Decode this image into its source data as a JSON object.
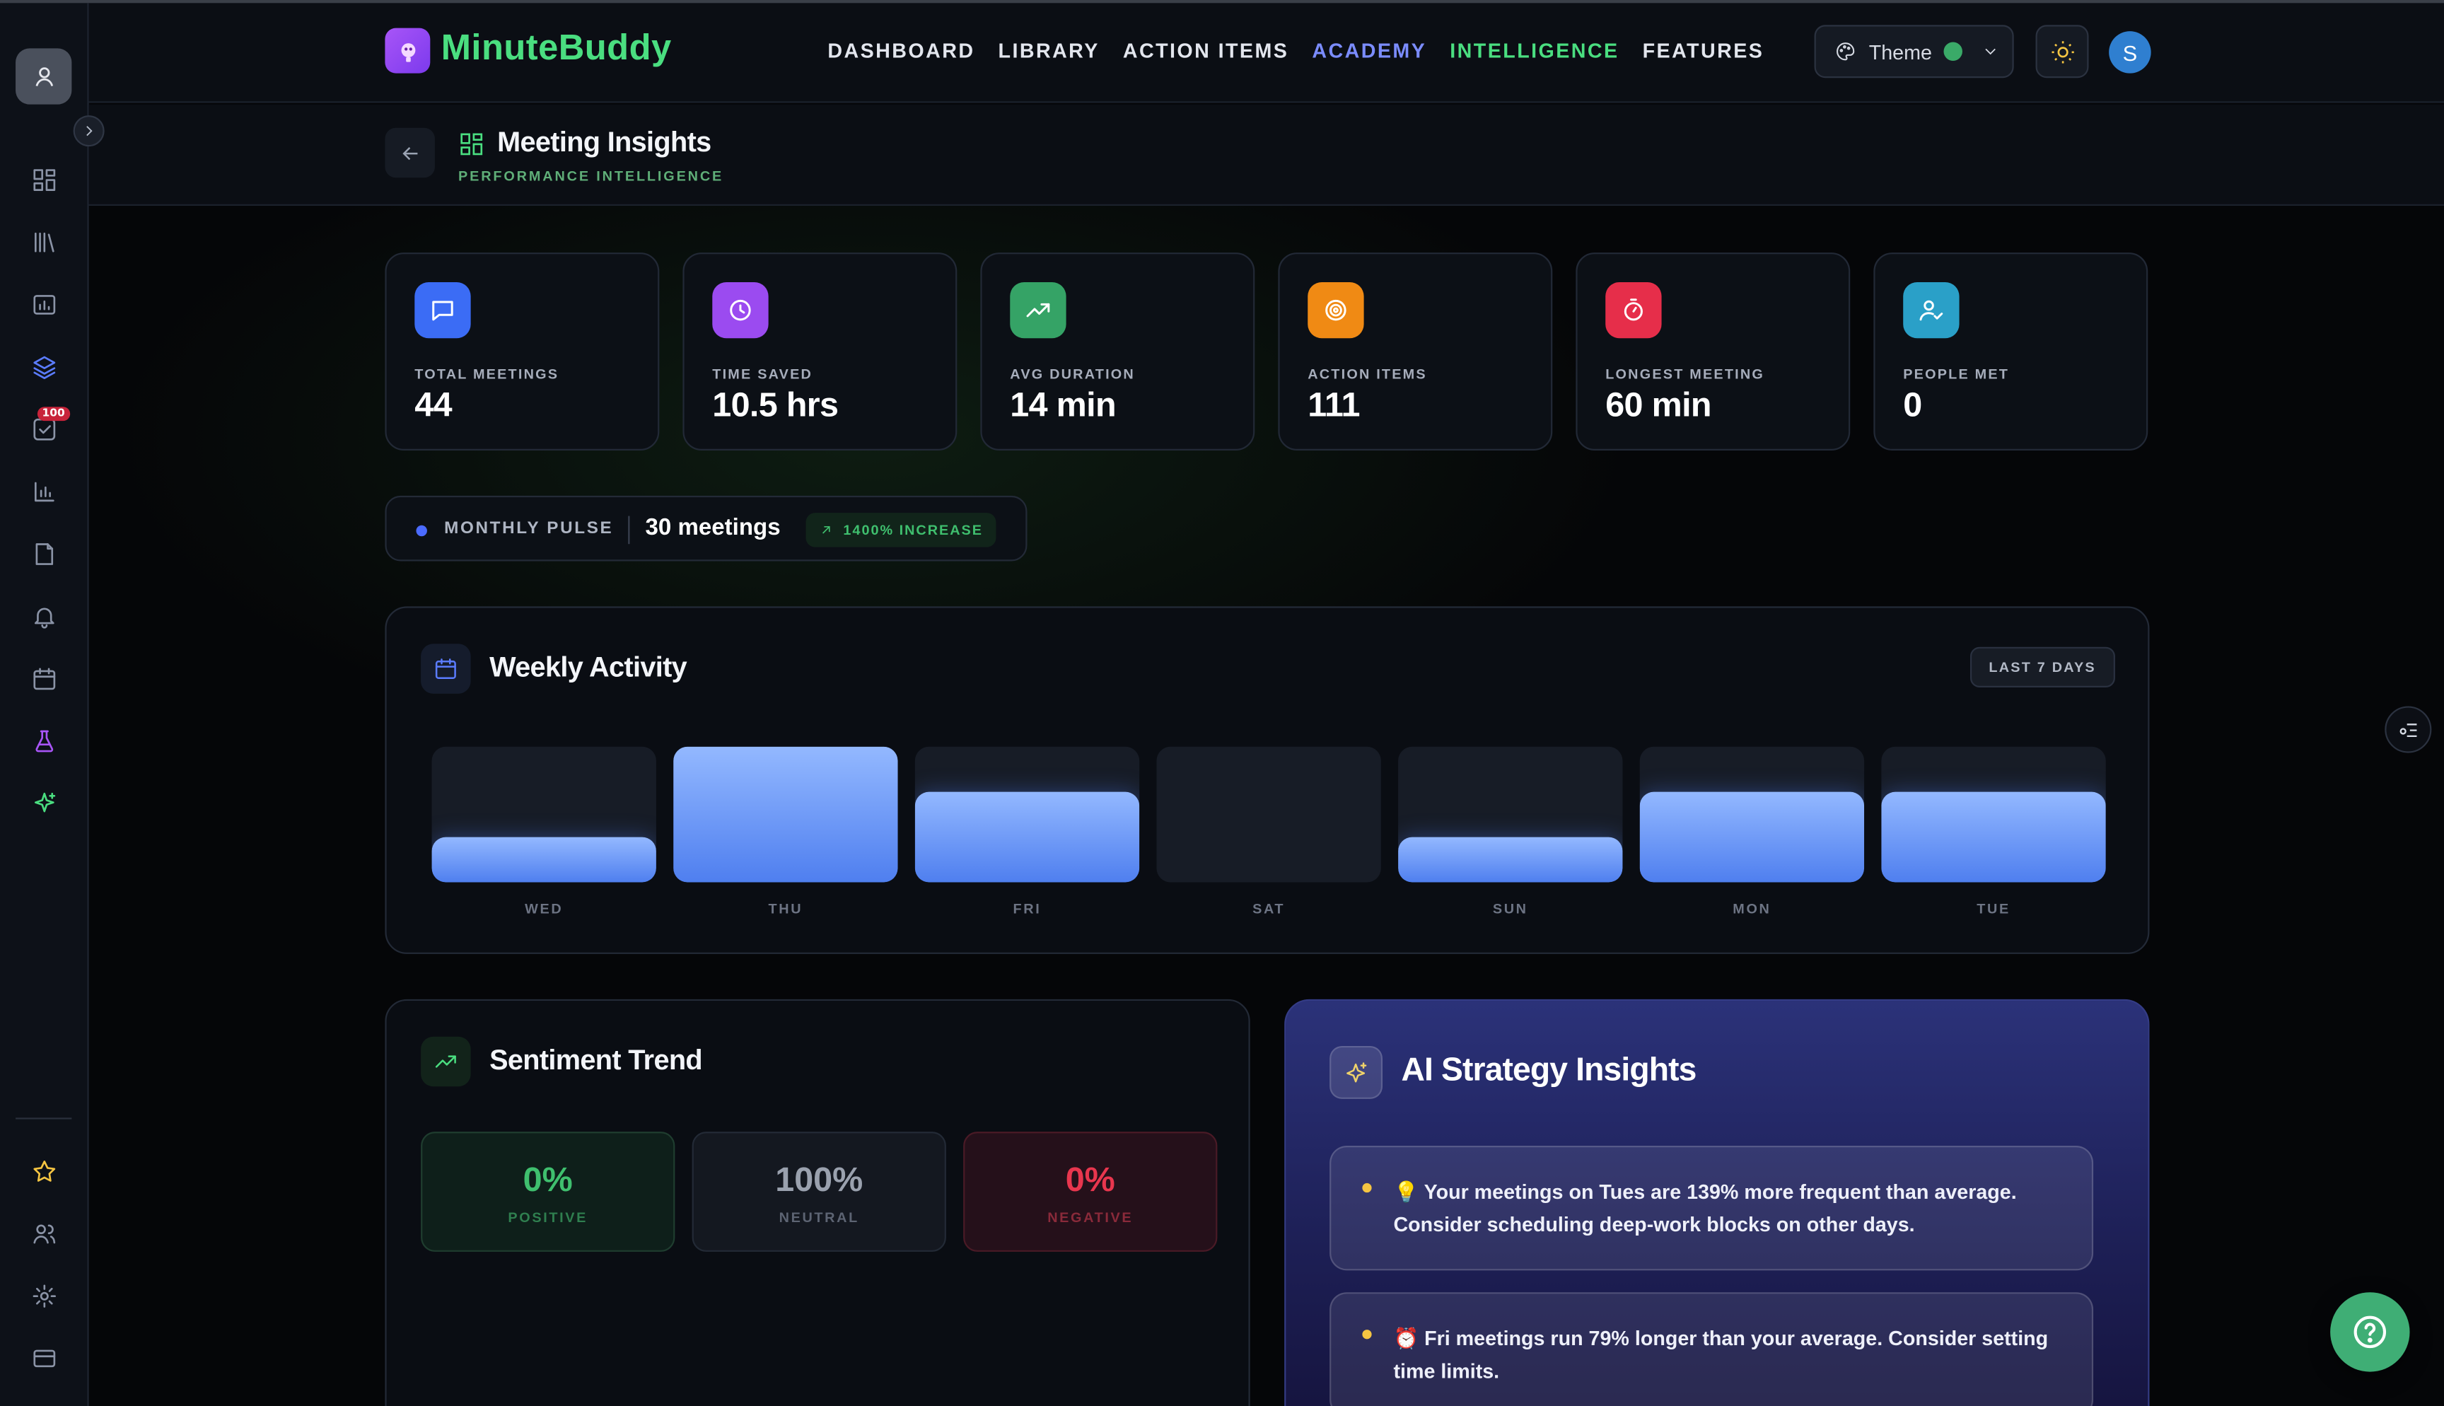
{
  "app": {
    "name": "MinuteBuddy"
  },
  "nav": [
    {
      "label": "DASHBOARD"
    },
    {
      "label": "LIBRARY"
    },
    {
      "label": "ACTION ITEMS"
    },
    {
      "label": "ACADEMY"
    },
    {
      "label": "INTELLIGENCE"
    },
    {
      "label": "FEATURES"
    }
  ],
  "header": {
    "theme_label": "Theme",
    "user_initial": "S"
  },
  "sidebar": {
    "badge": "100"
  },
  "page": {
    "title": "Meeting Insights",
    "subtitle": "PERFORMANCE INTELLIGENCE"
  },
  "stats": [
    {
      "label": "TOTAL MEETINGS",
      "value": "44",
      "icon": "chat-icon",
      "color": "#3b6cf5"
    },
    {
      "label": "TIME SAVED",
      "value": "10.5 hrs",
      "icon": "clock-icon",
      "color": "#9b4bf0"
    },
    {
      "label": "AVG DURATION",
      "value": "14 min",
      "icon": "trend-up-icon",
      "color": "#35a366"
    },
    {
      "label": "ACTION ITEMS",
      "value": "111",
      "icon": "target-icon",
      "color": "#f08a14"
    },
    {
      "label": "LONGEST MEETING",
      "value": "60 min",
      "icon": "stopwatch-icon",
      "color": "#e62e4a"
    },
    {
      "label": "PEOPLE MET",
      "value": "0",
      "icon": "user-check-icon",
      "color": "#2aa0c8"
    }
  ],
  "pulse": {
    "label": "MONTHLY PULSE",
    "value": "30 meetings",
    "badge": "1400% INCREASE"
  },
  "weekly": {
    "title": "Weekly Activity",
    "range": "LAST 7 DAYS"
  },
  "chart_data": {
    "type": "bar",
    "categories": [
      "WED",
      "THU",
      "FRI",
      "SAT",
      "SUN",
      "MON",
      "TUE"
    ],
    "values": [
      1,
      3,
      2,
      0,
      1,
      2,
      2
    ]
  },
  "sentiment": {
    "title": "Sentiment Trend",
    "items": [
      {
        "value": "0%",
        "label": "POSITIVE"
      },
      {
        "value": "100%",
        "label": "NEUTRAL"
      },
      {
        "value": "0%",
        "label": "NEGATIVE"
      }
    ]
  },
  "ai": {
    "title": "AI Strategy Insights",
    "insights": [
      {
        "text": "💡 Your meetings on Tues are 139% more frequent than average. Consider scheduling deep-work blocks on other days."
      },
      {
        "text": "⏰ Fri meetings run 79% longer than your average. Consider setting time limits."
      }
    ]
  },
  "colors": {
    "accent_green": "#4ade80",
    "accent_blue": "#7b8cff",
    "bar": "#4f7fef",
    "positive": "#3fbf6e",
    "neutral": "#9aa1ae",
    "negative": "#e8364e"
  }
}
